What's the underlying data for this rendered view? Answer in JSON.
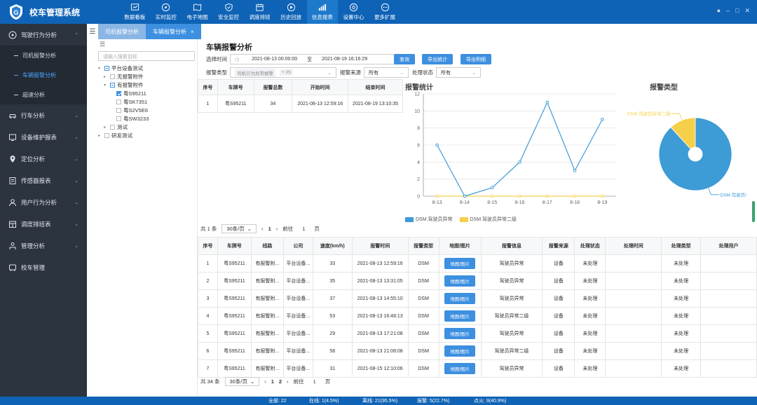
{
  "app": {
    "title": "校车管理系统"
  },
  "nav": [
    {
      "label": "数据看板",
      "icon": "dashboard-icon"
    },
    {
      "label": "实时监控",
      "icon": "compass-icon"
    },
    {
      "label": "电子地图",
      "icon": "map-icon"
    },
    {
      "label": "安全监控",
      "icon": "shield-icon"
    },
    {
      "label": "调度排班",
      "icon": "calendar-icon"
    },
    {
      "label": "历史回放",
      "icon": "replay-icon"
    },
    {
      "label": "信息报表",
      "icon": "report-icon"
    },
    {
      "label": "设置中心",
      "icon": "gear-icon"
    },
    {
      "label": "更多扩展",
      "icon": "more-icon"
    }
  ],
  "sidebar": {
    "menus": [
      {
        "label": "驾驶行为分析",
        "icon": "steering-icon"
      },
      {
        "label": "行车分析",
        "icon": "car-icon"
      },
      {
        "label": "设备维护报表",
        "icon": "device-icon"
      },
      {
        "label": "定位分析",
        "icon": "location-icon"
      },
      {
        "label": "传感器报表",
        "icon": "sensor-icon"
      },
      {
        "label": "用户行为分析",
        "icon": "user-icon"
      },
      {
        "label": "调度排班表",
        "icon": "schedule-icon"
      },
      {
        "label": "管理分析",
        "icon": "manage-icon"
      },
      {
        "label": "校车管理",
        "icon": "bus-icon"
      }
    ],
    "submenus": [
      {
        "label": "司机报警分析"
      },
      {
        "label": "车辆报警分析"
      },
      {
        "label": "超速分析"
      }
    ]
  },
  "tabs": [
    {
      "label": "司机报警分析"
    },
    {
      "label": "车辆报警分析",
      "close": "×"
    }
  ],
  "tree": {
    "search_placeholder": "请输入搜索目标",
    "nodes": [
      "平台设备测试",
      "无报警附件",
      "有报警附件",
      "粤S95211",
      "粤SK7351",
      "粤S2V5E6",
      "粤SW3233",
      "测试",
      "研发测试"
    ]
  },
  "main": {
    "title": "车辆报警分析",
    "time_label": "选择时间",
    "time_start": "2021-08-13 00:00:00",
    "time_to": "至",
    "time_end": "2021-08-19 16:16:29",
    "btn_query": "查询",
    "btn_export_stats": "导出统计",
    "btn_export_detail": "导出明细",
    "type_label": "报警类型",
    "type_value": "司机行为异常报警",
    "type_more": "+ 25",
    "source_label": "报警来源",
    "source_value": "所有",
    "status_label": "处理状态",
    "status_value": "所有"
  },
  "summary_table": {
    "headers": [
      "序号",
      "车牌号",
      "报警总数",
      "开始时间",
      "结束时间"
    ],
    "rows": [
      [
        "1",
        "粤S95211",
        "34",
        "2021-08-13 12:59:16",
        "2021-08-19 13:10:35"
      ]
    ]
  },
  "summary_pager": {
    "total": "共 1 条",
    "size": "30条/页",
    "page": "1",
    "goto": "前往",
    "goto_page": "1",
    "unit": "页"
  },
  "detail_table": {
    "headers": [
      "序号",
      "车牌号",
      "线路",
      "公司",
      "速度(km/h)",
      "报警时间",
      "报警类型",
      "地图/图片",
      "报警信息",
      "报警来源",
      "处理状态",
      "处理时间",
      "处理类型",
      "处理用户"
    ],
    "button_label": "地图/图片",
    "rows": [
      [
        "1",
        "粤S95211",
        "有报警附...",
        "平台设备...",
        "33",
        "2021-08-13 12:59:16",
        "DSM",
        "",
        "驾驶员异常",
        "设备",
        "未处理",
        "",
        "未处理",
        ""
      ],
      [
        "2",
        "粤S95211",
        "有报警附...",
        "平台设备...",
        "35",
        "2021-08-13 13:31:05",
        "DSM",
        "",
        "驾驶员异常",
        "设备",
        "未处理",
        "",
        "未处理",
        ""
      ],
      [
        "3",
        "粤S95211",
        "有报警附...",
        "平台设备...",
        "37",
        "2021-08-13 14:55:10",
        "DSM",
        "",
        "驾驶员异常",
        "设备",
        "未处理",
        "",
        "未处理",
        ""
      ],
      [
        "4",
        "粤S95211",
        "有报警附...",
        "平台设备...",
        "53",
        "2021-08-13 16:48:13",
        "DSM",
        "",
        "驾驶员异常二级",
        "设备",
        "未处理",
        "",
        "未处理",
        ""
      ],
      [
        "5",
        "粤S95211",
        "有报警附...",
        "平台设备...",
        "29",
        "2021-08-13 17:21:08",
        "DSM",
        "",
        "驾驶员异常",
        "设备",
        "未处理",
        "",
        "未处理",
        ""
      ],
      [
        "6",
        "粤S95211",
        "有报警附...",
        "平台设备...",
        "58",
        "2021-08-13 21:08:08",
        "DSM",
        "",
        "驾驶员异常二级",
        "设备",
        "未处理",
        "",
        "未处理",
        ""
      ],
      [
        "7",
        "粤S95211",
        "有报警附...",
        "平台设备...",
        "31",
        "2021-08-15 12:10:06",
        "DSM",
        "",
        "驾驶员异常",
        "设备",
        "未处理",
        "",
        "未处理",
        ""
      ]
    ]
  },
  "detail_pager": {
    "total": "共 34 条",
    "size": "30条/页",
    "page1": "1",
    "page2": "2",
    "goto": "前往",
    "goto_page": "1",
    "unit": "页"
  },
  "chart_data": [
    {
      "type": "line",
      "title": "报警统计",
      "categories": [
        "8-13",
        "8-14",
        "8-15",
        "8-16",
        "8-17",
        "8-18",
        "8-19"
      ],
      "series": [
        {
          "name": "DSM.驾驶员异常",
          "values": [
            6,
            0,
            1,
            4,
            11,
            3,
            9
          ],
          "color": "#3d9bd6"
        },
        {
          "name": "DSM.驾驶员异常二级",
          "values": [
            0,
            0,
            0,
            0,
            0,
            0,
            0
          ],
          "color": "#f7d04a"
        }
      ],
      "ylim": [
        0,
        12
      ],
      "yticks": [
        0,
        2,
        4,
        6,
        8,
        10,
        12
      ],
      "grid": true,
      "legend": "bottom-left"
    },
    {
      "type": "pie",
      "title": "报警类型",
      "slices": [
        {
          "name": "DSM.驾驶员异常",
          "label": "DSM.驾驶员!",
          "value": 30,
          "color": "#3d9bd6"
        },
        {
          "name": "DSM.驾驶员异常二级",
          "label": "DSM.驾驶员异常二级",
          "value": 4,
          "color": "#f7d04a"
        }
      ]
    }
  ],
  "status": {
    "all": "全部: 22",
    "online": "在线: 1(4.5%)",
    "offline": "离线: 21(95.5%)",
    "alarm": "报警: 5(22.7%)",
    "fire": "点火: 9(40.9%)"
  },
  "colors": {
    "primary": "#0f63b6",
    "accent": "#3d8fe0",
    "sidebar": "#2c3440"
  }
}
